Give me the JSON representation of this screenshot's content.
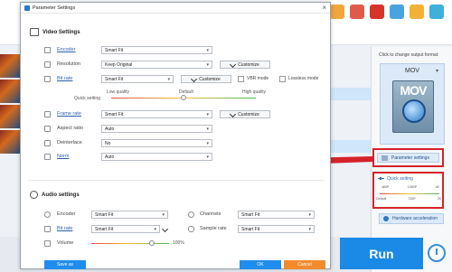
{
  "dialog": {
    "title": "Parameter Settings",
    "video_section": "Video Settings",
    "audio_section": "Audio settings",
    "video_rows": {
      "encoder": {
        "label": "Encoder",
        "value": "Smart Fit"
      },
      "resolution": {
        "label": "Resolution",
        "value": "Keep Original",
        "button": "Customize"
      },
      "bitrate": {
        "label": "Bit rate",
        "value": "Smart Fit",
        "button": "Customize",
        "vbr": "VBR mode",
        "lossless": "Lossless mode"
      },
      "framerate": {
        "label": "Frame rate",
        "value": "Smart Fit",
        "button": "Customize"
      },
      "aspect": {
        "label": "Aspect ratio",
        "value": "Auto"
      },
      "deinterlace": {
        "label": "Deinterlace",
        "value": "No"
      },
      "norm": {
        "label": "Norm",
        "value": "Auto"
      }
    },
    "quality": {
      "low": "Low quality",
      "default": "Default",
      "high": "High quality",
      "quick": "Quick setting",
      "level": 0.5
    },
    "audio_rows": {
      "encoder": {
        "label": "Encoder",
        "value": "Smart Fit"
      },
      "channels": {
        "label": "Channels",
        "value": "Smart Fit"
      },
      "bitrate": {
        "label": "Bit rate",
        "value": "Smart Fit"
      },
      "samplerate": {
        "label": "Sample rate",
        "value": "Smart Fit"
      },
      "volume": {
        "label": "Volume",
        "value": "100%",
        "level": 1.0
      }
    },
    "buttons": {
      "save_as": "Save as",
      "ok": "OK",
      "cancel": "Cancel"
    }
  },
  "right_panel": {
    "caption": "Click to change output format:",
    "format": "MOV",
    "format_icon_text": "MOV",
    "param_button": "Parameter settings",
    "quick_setting": "Quick setting",
    "quick_top_ticks": [
      "480P",
      "1080P",
      "4K"
    ],
    "quick_bottom_ticks": [
      "Default",
      "720P",
      "2K"
    ],
    "hw_button": "Hardware acceleration",
    "run": "Run"
  },
  "colors": {
    "accent": "#1f8ded",
    "highlight": "#d4232b",
    "cancel": "#f28b2e"
  }
}
